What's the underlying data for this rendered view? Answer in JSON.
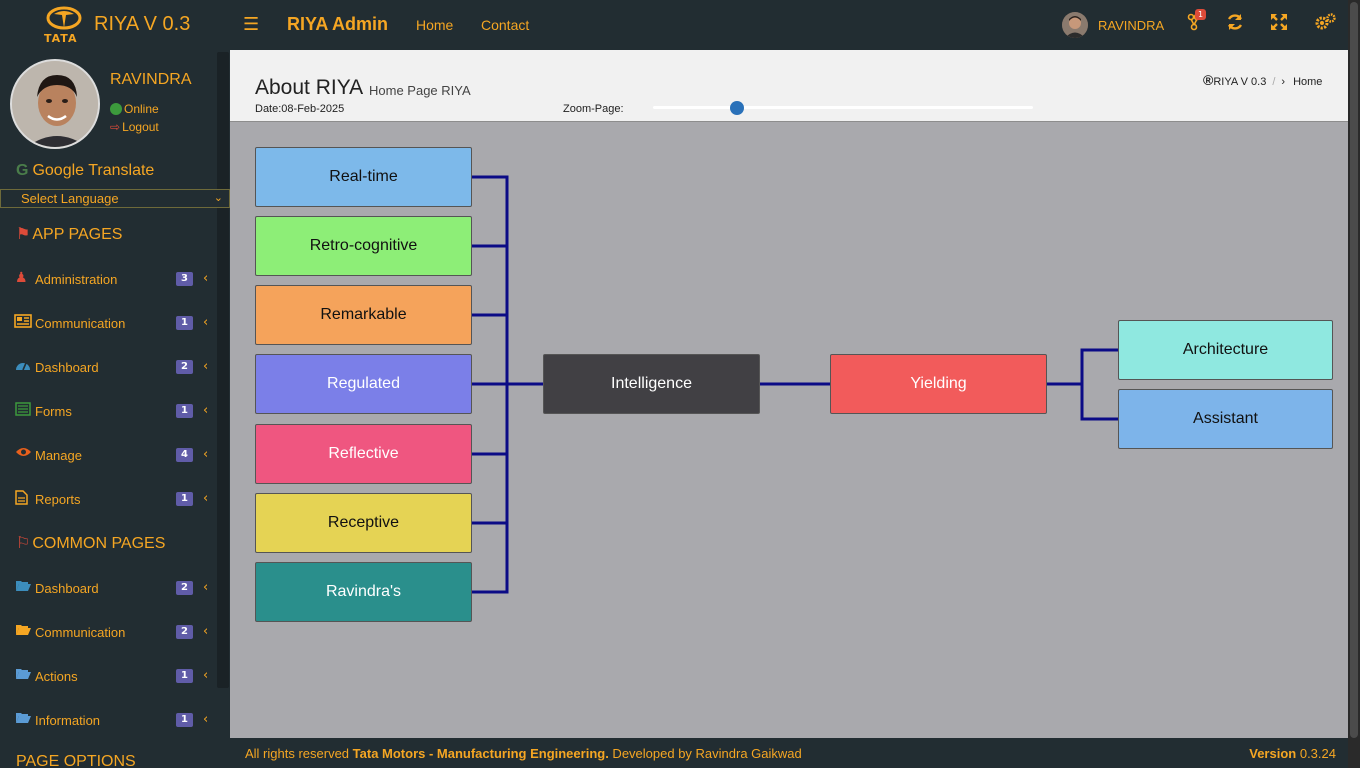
{
  "topbar": {
    "logo_text": "TATA",
    "brand_title": "RIYA V 0.3",
    "app_name": "RIYA Admin",
    "nav": [
      "Home",
      "Contact"
    ],
    "user_name": "RAVINDRA",
    "notification_count": "1",
    "icons": [
      "menu-icon",
      "users-icon",
      "refresh-icon",
      "expand-icon",
      "settings-icon"
    ]
  },
  "sidebar": {
    "profile_name": "RAVINDRA",
    "status": "Online",
    "logout": "Logout",
    "google_translate": "Google Translate",
    "language_select": "Select Language",
    "app_pages_header": "APP PAGES",
    "app_pages": [
      {
        "label": "Administration",
        "badge": "3",
        "icon": "user-secret-icon"
      },
      {
        "label": "Communication",
        "badge": "1",
        "icon": "newspaper-icon"
      },
      {
        "label": "Dashboard",
        "badge": "2",
        "icon": "dashboard-icon"
      },
      {
        "label": "Forms",
        "badge": "1",
        "icon": "list-icon"
      },
      {
        "label": "Manage",
        "badge": "4",
        "icon": "eye-icon"
      },
      {
        "label": "Reports",
        "badge": "1",
        "icon": "file-icon"
      }
    ],
    "common_pages_header": "COMMON PAGES",
    "common_pages": [
      {
        "label": "Dashboard",
        "badge": "2",
        "icon": "folder-open-icon"
      },
      {
        "label": "Communication",
        "badge": "2",
        "icon": "folder-open-icon"
      },
      {
        "label": "Actions",
        "badge": "1",
        "icon": "folder-open-icon"
      },
      {
        "label": "Information",
        "badge": "1",
        "icon": "folder-open-icon"
      }
    ],
    "page_options_header": "PAGE OPTIONS"
  },
  "page": {
    "title": "About RIYA",
    "subtitle": "Home Page RIYA",
    "date": "Date:08-Feb-2025",
    "zoom_label": "Zoom-Page:",
    "zoom_value": 0.22,
    "breadcrumb_root": "RIYA V 0.3",
    "breadcrumb_sep": "/",
    "breadcrumb_current": "Home"
  },
  "diagram": {
    "left_nodes": [
      {
        "label": "Real-time",
        "color": "#7db9ea",
        "text": "#111"
      },
      {
        "label": "Retro-cognitive",
        "color": "#8dee77",
        "text": "#111"
      },
      {
        "label": "Remarkable",
        "color": "#f5a35b",
        "text": "#111"
      },
      {
        "label": "Regulated",
        "color": "#7b7fe8",
        "text": "#fff"
      },
      {
        "label": "Reflective",
        "color": "#ef5680",
        "text": "#fff"
      },
      {
        "label": "Receptive",
        "color": "#e5d354",
        "text": "#111"
      },
      {
        "label": "Ravindra's",
        "color": "#2a8f8c",
        "text": "#fff"
      }
    ],
    "center_node": {
      "label": "Intelligence",
      "color": "#414044",
      "text": "#fff"
    },
    "middle_node": {
      "label": "Yielding",
      "color": "#f25b5b",
      "text": "#fff"
    },
    "right_nodes": [
      {
        "label": "Architecture",
        "color": "#8fe8e0",
        "text": "#111"
      },
      {
        "label": "Assistant",
        "color": "#7db4ea",
        "text": "#111"
      }
    ],
    "connector_color": "#0b0b86"
  },
  "footer": {
    "prefix": "All rights reserved ",
    "company": "Tata Motors - Manufacturing Engineering.",
    "developer": " Developed by Ravindra Gaikwad",
    "version_label": "Version",
    "version": "0.3.24"
  }
}
